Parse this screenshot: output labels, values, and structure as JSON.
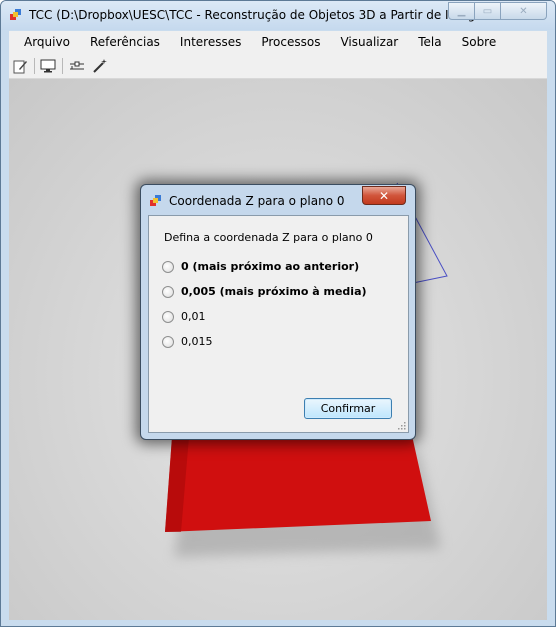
{
  "window": {
    "title": "TCC (D:\\Dropbox\\UESC\\TCC - Reconstrução de Objetos 3D a Partir de Image...",
    "minimize_icon": "minimize-icon",
    "maximize_icon": "maximize-icon",
    "close_icon": "close-icon"
  },
  "menu": {
    "items": [
      {
        "label": "Arquivo"
      },
      {
        "label": "Referências"
      },
      {
        "label": "Interesses"
      },
      {
        "label": "Processos"
      },
      {
        "label": "Visualizar"
      },
      {
        "label": "Tela"
      },
      {
        "label": "Sobre"
      }
    ]
  },
  "toolbar": {
    "icons": [
      "edit-icon",
      "monitor-icon",
      "connect-icon",
      "magic-wand-icon"
    ]
  },
  "dialog": {
    "title": "Coordenada Z para o plano 0",
    "prompt": "Defina a coordenada Z para o plano 0",
    "options": [
      {
        "label": "0 (mais próximo ao anterior)",
        "bold": true
      },
      {
        "label": "0,005 (mais próximo à media)",
        "bold": true
      },
      {
        "label": "0,01",
        "bold": false
      },
      {
        "label": "0,015",
        "bold": false
      }
    ],
    "confirm_label": "Confirmar"
  },
  "colors": {
    "plane_red": "#d00f0f",
    "wireframe_blue": "#4a4fc4",
    "title_bar": "#c9dcee",
    "dialog_close": "#c23a1e"
  }
}
